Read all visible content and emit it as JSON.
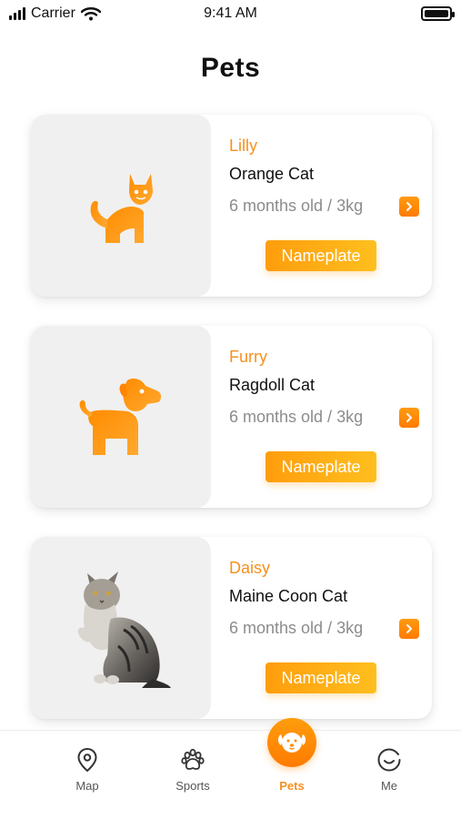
{
  "status_bar": {
    "carrier": "Carrier",
    "time": "9:41 AM"
  },
  "page": {
    "title": "Pets"
  },
  "pets": [
    {
      "name": "Lilly",
      "breed": "Orange Cat",
      "meta": "6 months old / 3kg",
      "nameplate_label": "Nameplate",
      "photo_icon": "cat-icon"
    },
    {
      "name": "Furry",
      "breed": "Ragdoll Cat",
      "meta": "6 months old / 3kg",
      "nameplate_label": "Nameplate",
      "photo_icon": "dog-icon"
    },
    {
      "name": "Daisy",
      "breed": "Maine Coon Cat",
      "meta": "6 months old / 3kg",
      "nameplate_label": "Nameplate",
      "photo_icon": "maine-coon-photo"
    }
  ],
  "tabs": {
    "map": "Map",
    "sports": "Sports",
    "pets": "Pets",
    "me": "Me"
  },
  "colors": {
    "accent": "#f7901e",
    "accent_light": "#ffbf1e",
    "photo_bg": "#f0f0f0",
    "meta_text": "#8c8c8c"
  }
}
